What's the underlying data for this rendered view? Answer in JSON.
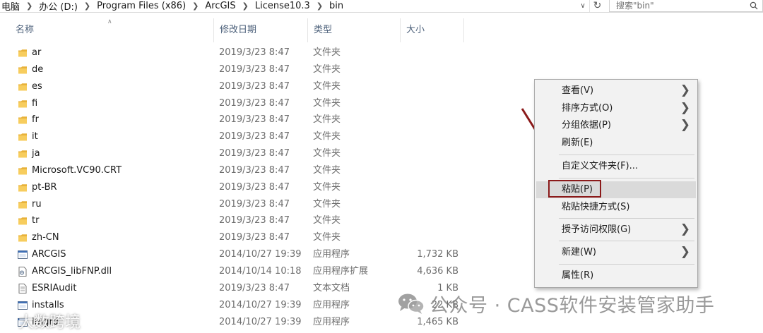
{
  "breadcrumb": [
    "电脑",
    "办公 (D:)",
    "Program Files (x86)",
    "ArcGIS",
    "License10.3",
    "bin"
  ],
  "search": {
    "placeholder": "搜索\"bin\""
  },
  "columns": {
    "name": "名称",
    "date": "修改日期",
    "type": "类型",
    "size": "大小"
  },
  "files": [
    {
      "name": "ar",
      "date": "2019/3/23 8:47",
      "type": "文件夹",
      "size": "",
      "icon": "folder-icon"
    },
    {
      "name": "de",
      "date": "2019/3/23 8:47",
      "type": "文件夹",
      "size": "",
      "icon": "folder-icon"
    },
    {
      "name": "es",
      "date": "2019/3/23 8:47",
      "type": "文件夹",
      "size": "",
      "icon": "folder-icon"
    },
    {
      "name": "fi",
      "date": "2019/3/23 8:47",
      "type": "文件夹",
      "size": "",
      "icon": "folder-icon"
    },
    {
      "name": "fr",
      "date": "2019/3/23 8:47",
      "type": "文件夹",
      "size": "",
      "icon": "folder-icon"
    },
    {
      "name": "it",
      "date": "2019/3/23 8:47",
      "type": "文件夹",
      "size": "",
      "icon": "folder-icon"
    },
    {
      "name": "ja",
      "date": "2019/3/23 8:47",
      "type": "文件夹",
      "size": "",
      "icon": "folder-icon"
    },
    {
      "name": "Microsoft.VC90.CRT",
      "date": "2019/3/23 8:47",
      "type": "文件夹",
      "size": "",
      "icon": "folder-icon"
    },
    {
      "name": "pt-BR",
      "date": "2019/3/23 8:47",
      "type": "文件夹",
      "size": "",
      "icon": "folder-icon"
    },
    {
      "name": "ru",
      "date": "2019/3/23 8:47",
      "type": "文件夹",
      "size": "",
      "icon": "folder-icon"
    },
    {
      "name": "tr",
      "date": "2019/3/23 8:47",
      "type": "文件夹",
      "size": "",
      "icon": "folder-icon"
    },
    {
      "name": "zh-CN",
      "date": "2019/3/23 8:47",
      "type": "文件夹",
      "size": "",
      "icon": "folder-icon"
    },
    {
      "name": "ARCGIS",
      "date": "2014/10/27 19:39",
      "type": "应用程序",
      "size": "1,732 KB",
      "icon": "application-icon"
    },
    {
      "name": "ARCGIS_libFNP.dll",
      "date": "2014/10/14 10:18",
      "type": "应用程序扩展",
      "size": "4,636 KB",
      "icon": "dll-file-icon"
    },
    {
      "name": "ESRIAudit",
      "date": "2019/3/23 8:47",
      "type": "文本文档",
      "size": "1 KB",
      "icon": "text-file-icon"
    },
    {
      "name": "installs",
      "date": "2014/10/27 19:39",
      "type": "应用程序",
      "size": "22 KB",
      "icon": "application-icon"
    },
    {
      "name": "lmgrd",
      "date": "2014/10/27 19:39",
      "type": "应用程序",
      "size": "1,465 KB",
      "icon": "application-icon"
    }
  ],
  "context_menu": {
    "view": "查看(V)",
    "sort": "排序方式(O)",
    "group": "分组依据(P)",
    "refresh": "刷新(E)",
    "customize": "自定义文件夹(F)...",
    "paste": "粘贴(P)",
    "paste_shortcut": "粘贴快捷方式(S)",
    "grant_access": "授予访问权限(G)",
    "new": "新建(W)",
    "properties": "属性(R)"
  },
  "watermarks": {
    "right": "公众号 · CASS软件安装管家助手",
    "left": "大数跨境"
  },
  "colors": {
    "folder": "#f4c542",
    "highlight_box": "#8b1a1a",
    "arrow": "#8b1a1a",
    "menu_bg": "#f2f2f2"
  }
}
